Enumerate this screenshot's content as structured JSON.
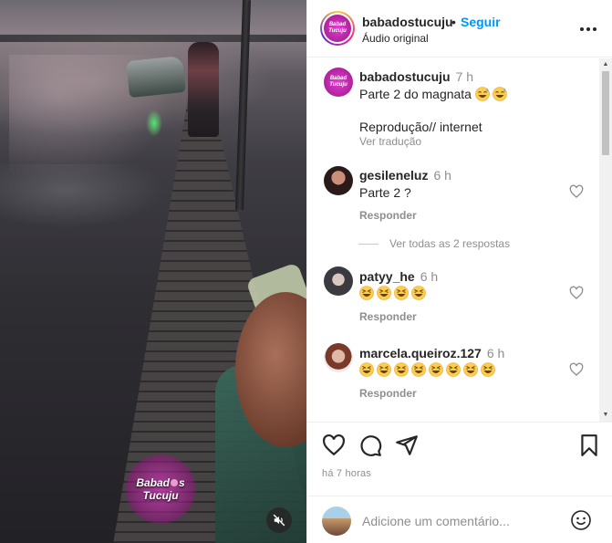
{
  "post": {
    "author": "babadostucuju",
    "separator": "•",
    "follow_label": "Seguir",
    "audio": "Áudio original",
    "time_ago": "há 7 horas",
    "watermark_line1": "Babad",
    "watermark_line1b": "s",
    "watermark_line2": "Tucuju",
    "logo_line1": "Babad",
    "logo_line2": "Tucuju"
  },
  "caption": {
    "username": "babadostucuju",
    "time": "7 h",
    "text": "Parte 2 do magnata",
    "emoji_count": 2,
    "line2": "Reprodução// internet",
    "translate_label": "Ver tradução"
  },
  "comments": [
    {
      "username": "gesileneluz",
      "time": "6 h",
      "text": "Parte 2 ?",
      "emoji_count": 0,
      "reply_label": "Responder",
      "view_replies_label": "Ver todas as 2 respostas"
    },
    {
      "username": "patyy_he",
      "time": "6 h",
      "text": "",
      "emoji_count": 4,
      "reply_label": "Responder"
    },
    {
      "username": "marcela.queiroz.127",
      "time": "6 h",
      "text": "",
      "emoji_count": 8,
      "reply_label": "Responder"
    }
  ],
  "composer": {
    "placeholder": "Adicione um comentário..."
  },
  "icons": {
    "mute": "speaker-muted-icon",
    "more": "more-horizontal-icon",
    "like": "heart-icon",
    "comment": "comment-bubble-icon",
    "share": "paper-plane-icon",
    "save": "bookmark-icon",
    "emoji": "smiley-icon",
    "laugh_emoji": "grinning-squinting-face",
    "sweat_emoji": "grinning-sweat-face"
  },
  "colors": {
    "follow_blue": "#0095f6",
    "brand_magenta": "#c322b0",
    "muted_text": "#8e8e8e",
    "primary_text": "#262626"
  }
}
